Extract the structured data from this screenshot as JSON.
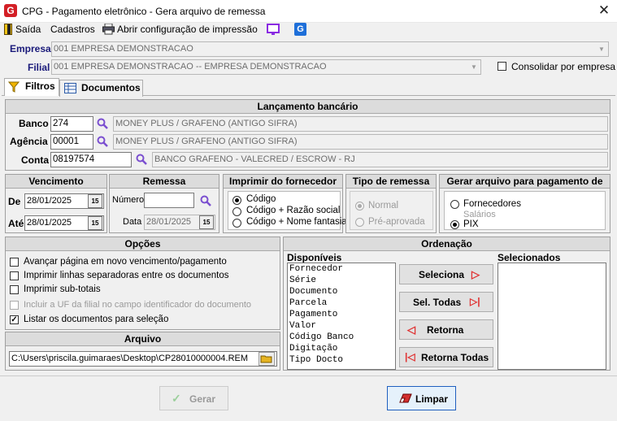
{
  "window": {
    "title": "CPG -  Pagamento eletrônico - Gera arquivo de remessa",
    "app_icon": "G"
  },
  "menu": {
    "exit": "Saída",
    "register": "Cadastros",
    "print_config": "Abrir configuração de impressão"
  },
  "empresa": {
    "label": "Empresa",
    "value": "001 EMPRESA DEMONSTRACAO"
  },
  "filial": {
    "label": "Filial",
    "value": "001 EMPRESA DEMONSTRACAO -- EMPRESA DEMONSTRACAO"
  },
  "consolidate": {
    "label": "Consolidar por empresa",
    "checked": false
  },
  "tabs": [
    {
      "label": "Filtros"
    },
    {
      "label": "Documentos"
    }
  ],
  "bank": {
    "title": "Lançamento bancário",
    "banco": {
      "label": "Banco",
      "code": "274",
      "name": "MONEY PLUS / GRAFENO (ANTIGO SIFRA)"
    },
    "agencia": {
      "label": "Agência",
      "code": "00001",
      "name": "MONEY PLUS / GRAFENO (ANTIGO SIFRA)"
    },
    "conta": {
      "label": "Conta",
      "code": "08197574",
      "name": "BANCO GRAFENO - VALECRED / ESCROW - RJ"
    }
  },
  "vencimento": {
    "title": "Vencimento",
    "de_label": "De",
    "de": "28/01/2025",
    "ate_label": "Até",
    "ate": "28/01/2025"
  },
  "remessa": {
    "title": "Remessa",
    "numero_label": "Número",
    "numero": "",
    "data_label": "Data",
    "data": "28/01/2025"
  },
  "fornecedor": {
    "title": "Imprimir do fornecedor",
    "options": [
      "Código",
      "Código + Razão social",
      "Código + Nome fantasia"
    ]
  },
  "tipo": {
    "title": "Tipo de remessa",
    "options": [
      "Normal",
      "Pré-aprovada"
    ]
  },
  "gerar": {
    "title": "Gerar arquivo para pagamento de",
    "options": [
      "Fornecedores",
      "Salários",
      "PIX"
    ]
  },
  "opcoes": {
    "title": "Opções",
    "items": [
      "Avançar página em novo vencimento/pagamento",
      "Imprimir linhas separadoras entre os documentos",
      "Imprimir sub-totais",
      "Incluir a UF da filial no campo identificador do documento",
      "Listar os documentos para seleção"
    ]
  },
  "arquivo": {
    "title": "Arquivo",
    "path": "C:\\Users\\priscila.guimaraes\\Desktop\\CP28010000004.REM"
  },
  "ordenacao": {
    "title": "Ordenação",
    "available_label": "Disponíveis",
    "selected_label": "Selecionados",
    "available": [
      "Fornecedor",
      "Série",
      "Documento",
      "Parcela",
      "Pagamento",
      "Valor",
      "Código Banco",
      "Digitação",
      "Tipo Docto"
    ],
    "buttons": {
      "select": "Seleciona",
      "select_all": "Sel. Todas",
      "return": "Retorna",
      "return_all": "Retorna Todas"
    }
  },
  "footer": {
    "generate": "Gerar",
    "clear": "Limpar"
  }
}
